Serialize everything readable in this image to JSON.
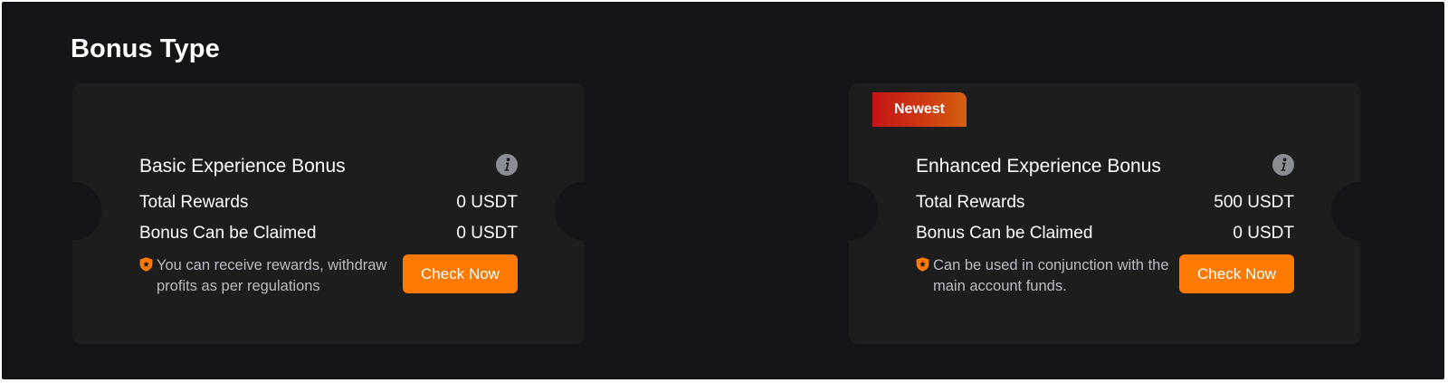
{
  "section": {
    "title": "Bonus Type"
  },
  "cards": [
    {
      "title": "Basic Experience Bonus",
      "rows": [
        {
          "label": "Total Rewards",
          "value": "0 USDT"
        },
        {
          "label": "Bonus Can be Claimed",
          "value": "0 USDT"
        }
      ],
      "note": "You can receive rewards, withdraw profits as per regulations",
      "button_label": "Check Now"
    },
    {
      "badge": "Newest",
      "title": "Enhanced Experience Bonus",
      "rows": [
        {
          "label": "Total Rewards",
          "value": "500 USDT"
        },
        {
          "label": "Bonus Can be Claimed",
          "value": "0 USDT"
        }
      ],
      "note": "Can be used in conjunction with the main account funds.",
      "button_label": "Check Now"
    }
  ],
  "colors": {
    "background": "#141518",
    "card": "#1d1d1d",
    "accent": "#ff7a00",
    "badge_start": "#c41415",
    "badge_end": "#d4610f",
    "note_text": "#b9bcc2"
  },
  "icons": {
    "info": "info-icon",
    "note": "shield-icon"
  }
}
